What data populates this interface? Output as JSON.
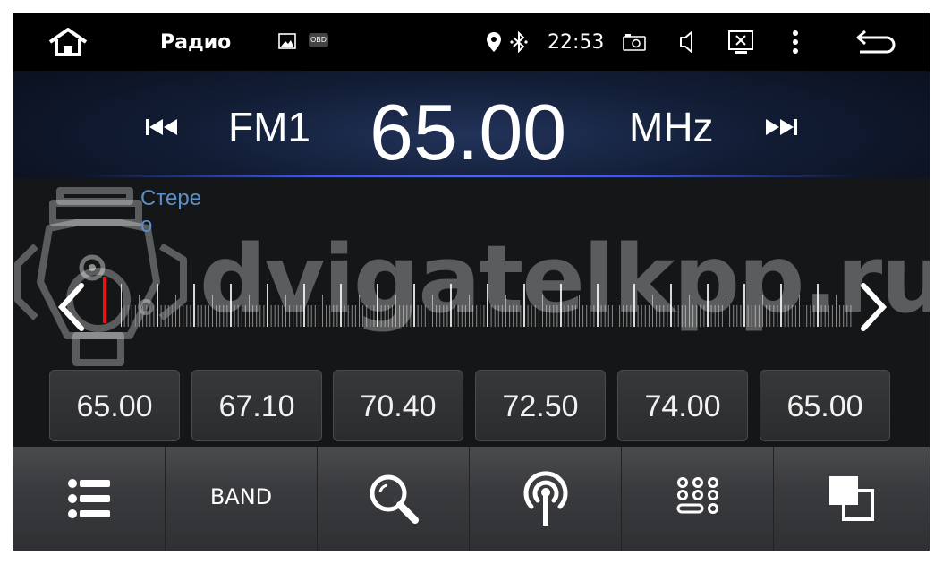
{
  "statusbar": {
    "title": "Радио",
    "obd_label": "OBD",
    "time": "22:53"
  },
  "tuner": {
    "band": "FM1",
    "frequency": "65.00",
    "unit": "MHz"
  },
  "dial": {
    "stereo_label": "Стерео",
    "watermark": "dvigatelkpp.ru"
  },
  "presets": [
    "65.00",
    "67.10",
    "70.40",
    "72.50",
    "74.00",
    "65.00"
  ],
  "toolbar": {
    "band_label": "BAND"
  },
  "icons": {
    "home": "home-icon",
    "image": "image-icon",
    "location": "location-icon",
    "bluetooth": "bluetooth-icon",
    "camera": "camera-icon",
    "volume": "volume-icon",
    "screen": "screen-off-icon",
    "menu": "more-vert-icon",
    "back": "back-icon",
    "list": "list-icon",
    "search": "search-icon",
    "antenna": "antenna-icon",
    "keypad": "keypad-icon",
    "window": "window-switch-icon"
  },
  "colors": {
    "accent_blue": "#3d55ff",
    "needle": "#ee1111",
    "stereo_text": "#5b8fc7"
  }
}
